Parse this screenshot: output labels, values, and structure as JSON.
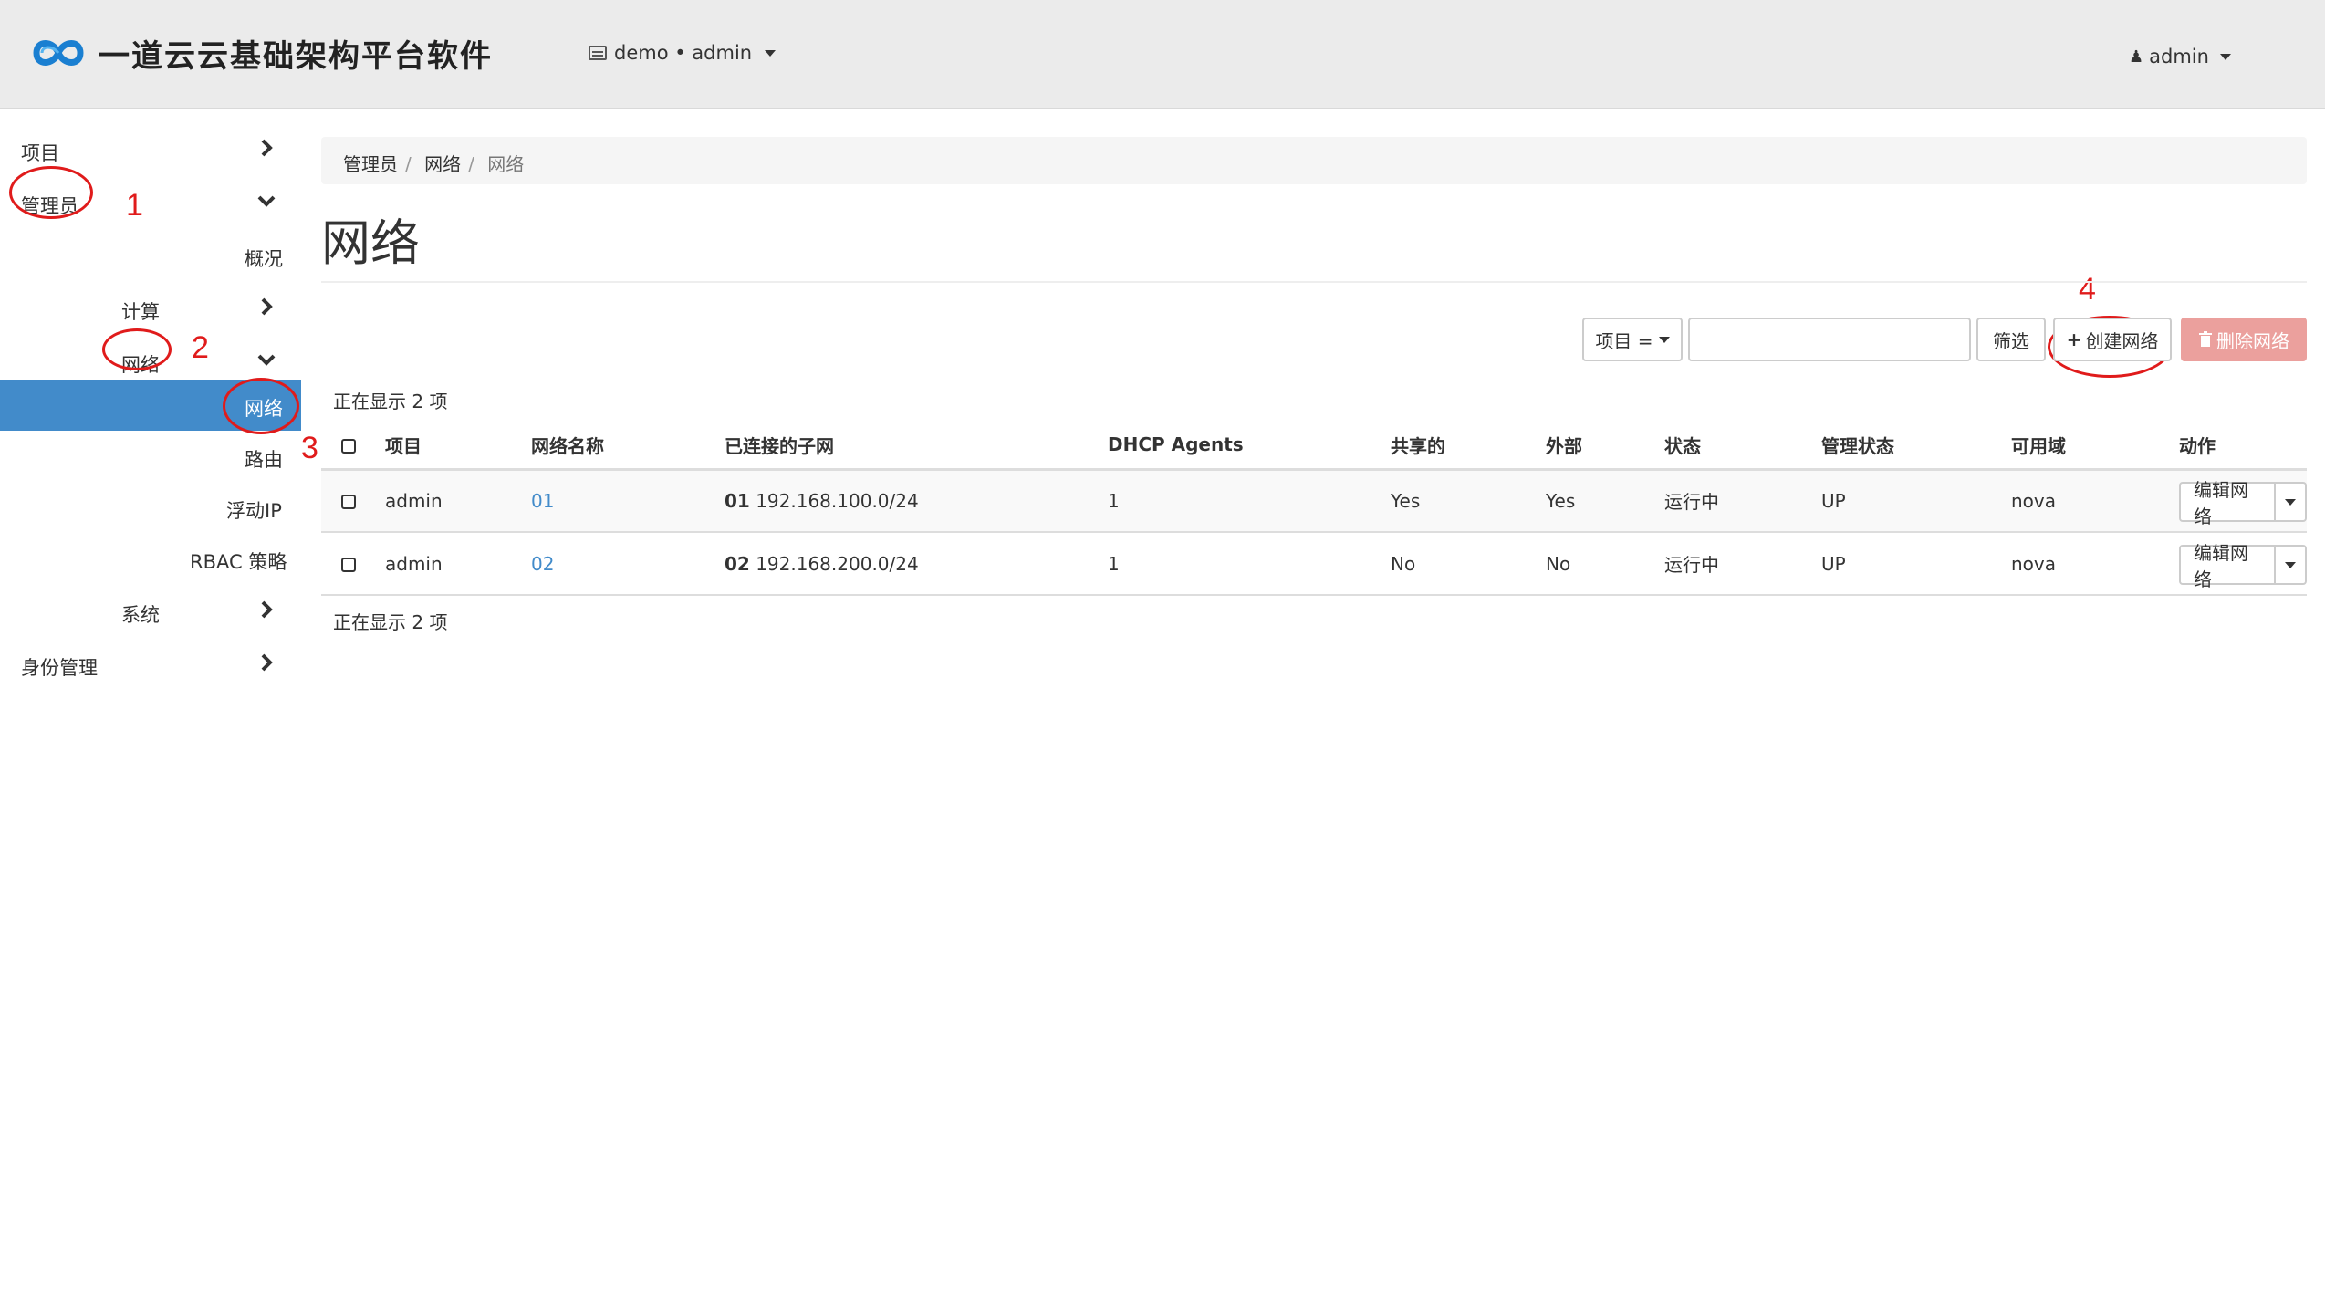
{
  "header": {
    "brand": "一道云云基础架构平台软件",
    "context_label": "demo • admin",
    "user_label": "admin"
  },
  "sidebar": {
    "items": [
      {
        "label": "项目"
      },
      {
        "label": "管理员"
      },
      {
        "label": "概况"
      },
      {
        "label": "计算"
      },
      {
        "label": "网络"
      },
      {
        "label": "网络"
      },
      {
        "label": "路由"
      },
      {
        "label": "浮动IP"
      },
      {
        "label": "RBAC 策略"
      },
      {
        "label": "系统"
      },
      {
        "label": "身份管理"
      }
    ]
  },
  "annotations": [
    "1",
    "2",
    "3",
    "4"
  ],
  "breadcrumb": [
    "管理员",
    "网络",
    "网络"
  ],
  "page_title": "网络",
  "toolbar": {
    "filter_field": "项目 =",
    "filter_value": "",
    "filter_button": "筛选",
    "create_button": "创建网络",
    "delete_button": "删除网络"
  },
  "table": {
    "count_label": "正在显示 2 项",
    "columns": [
      "项目",
      "网络名称",
      "已连接的子网",
      "DHCP Agents",
      "共享的",
      "外部",
      "状态",
      "管理状态",
      "可用域",
      "动作"
    ],
    "rows": [
      {
        "project": "admin",
        "name": "01",
        "subnet_name": "01",
        "subnet_cidr": "192.168.100.0/24",
        "dhcp": "1",
        "shared": "Yes",
        "external": "Yes",
        "status": "运行中",
        "admin_state": "UP",
        "az": "nova",
        "action": "编辑网络"
      },
      {
        "project": "admin",
        "name": "02",
        "subnet_name": "02",
        "subnet_cidr": "192.168.200.0/24",
        "dhcp": "1",
        "shared": "No",
        "external": "No",
        "status": "运行中",
        "admin_state": "UP",
        "az": "nova",
        "action": "编辑网络"
      }
    ]
  },
  "colors": {
    "active_nav": "#428bca",
    "link": "#428bca",
    "danger_disabled": "#eba09d",
    "annotation": "#e01b1b"
  }
}
